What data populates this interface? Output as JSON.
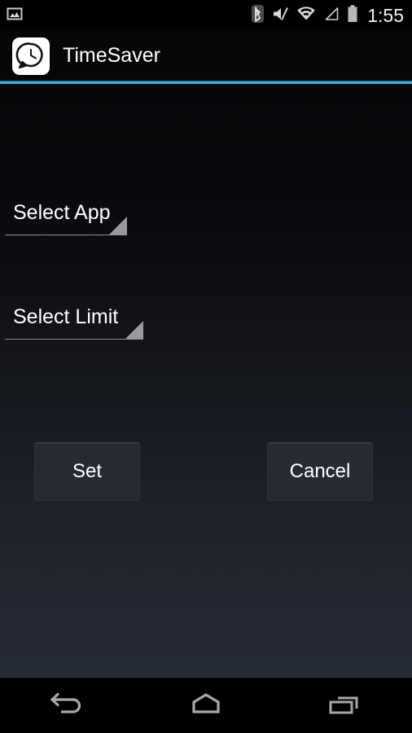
{
  "status_bar": {
    "notification_icons": [
      {
        "name": "screenshot-image-icon",
        "label": "Screenshot captured"
      }
    ],
    "system_icons": [
      {
        "name": "bluetooth-icon",
        "label": "Bluetooth"
      },
      {
        "name": "volume-mute-icon",
        "label": "Silent"
      },
      {
        "name": "wifi-icon",
        "label": "Wi-Fi"
      },
      {
        "name": "cell-signal-icon",
        "label": "Mobile signal"
      },
      {
        "name": "battery-icon",
        "label": "Battery"
      }
    ],
    "clock": "1:55"
  },
  "action_bar": {
    "app_icon_name": "timesaver-app-icon",
    "title": "TimeSaver",
    "accent_color": "#33b5e5"
  },
  "main": {
    "spinners": [
      {
        "name": "select-app-spinner",
        "label": "Select App"
      },
      {
        "name": "select-limit-spinner",
        "label": "Select Limit"
      }
    ],
    "buttons": [
      {
        "name": "set-button",
        "label": "Set"
      },
      {
        "name": "cancel-button",
        "label": "Cancel"
      }
    ]
  },
  "nav_bar": {
    "buttons": [
      {
        "name": "nav-back-button",
        "label": "Back"
      },
      {
        "name": "nav-home-button",
        "label": "Home"
      },
      {
        "name": "nav-recents-button",
        "label": "Recent apps"
      }
    ]
  },
  "colors": {
    "accent": "#33b5e5",
    "button_fill": "#262b33",
    "text": "#ffffff",
    "spinner_caret": "#9a9a9a"
  }
}
